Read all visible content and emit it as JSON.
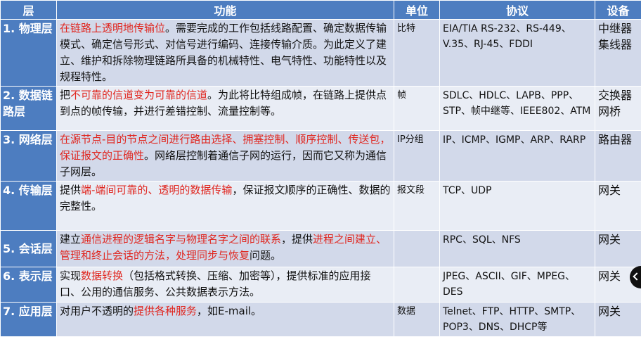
{
  "headers": {
    "layer": "层",
    "function": "功能",
    "unit": "单位",
    "protocol": "协议",
    "device": "设备"
  },
  "rows": [
    {
      "layer": "1. 物理层",
      "function": [
        {
          "t": "在链路上透明地传输位",
          "hl": true
        },
        {
          "t": "。需要完成的工作包括线路配置、确定数据传输模式、确定信号形式、对信号进行编码、连接传输介质。为此定义了建立、维护和拆除物理链路所具备的机械特性、电气特性、功能特性以及规程特性。",
          "hl": false
        }
      ],
      "unit": "比特",
      "protocol": "EIA/TIA RS-232、RS-449、V.35、RJ-45、FDDI",
      "device": "中继器 集线器"
    },
    {
      "layer": "2. 数据链路层",
      "function": [
        {
          "t": "把",
          "hl": false
        },
        {
          "t": "不可靠的信道变为可靠的信道",
          "hl": true
        },
        {
          "t": "。为此将比特组成帧，在链路上提供点到点的帧传输，并进行差错控制、流量控制等。",
          "hl": false
        }
      ],
      "unit": "帧",
      "protocol": "SDLC、HDLC、LAPB、PPP、STP、帧中继等、IEEE802、ATM",
      "device": "交换器 网桥"
    },
    {
      "layer": "3. 网络层",
      "function": [
        {
          "t": "在源节点-目的节点之间进行路由选择、拥塞控制、顺序控制、传送包，保证报文的正确性",
          "hl": true
        },
        {
          "t": "。网络层控制着通信子网的运行，因而它又称为通信子网层。",
          "hl": false
        }
      ],
      "unit": "IP分组",
      "protocol": "IP、ICMP、IGMP、ARP、RARP",
      "device": "路由器"
    },
    {
      "layer": "4. 传输层",
      "function": [
        {
          "t": "提供",
          "hl": false
        },
        {
          "t": "端-端间可靠的、透明的数据传输",
          "hl": true
        },
        {
          "t": "，保证报文顺序的正确性、数据的完整性。",
          "hl": false
        }
      ],
      "unit": "报文段",
      "protocol": "TCP、UDP",
      "device": "网关"
    },
    {
      "layer": "5. 会话层",
      "function": [
        {
          "t": "建立",
          "hl": false
        },
        {
          "t": "通信进程的逻辑名字与物理名字之间的联系",
          "hl": true
        },
        {
          "t": "，提供",
          "hl": false
        },
        {
          "t": "进程之间建立、管理和终止会话的方法，处理同步与恢复",
          "hl": true
        },
        {
          "t": "问题。",
          "hl": false
        }
      ],
      "unit": "",
      "protocol": "RPC、SQL、NFS",
      "device": "网关"
    },
    {
      "layer": "6. 表示层",
      "function": [
        {
          "t": "实现",
          "hl": false
        },
        {
          "t": "数据转换",
          "hl": true
        },
        {
          "t": "（包括格式转换、压缩、加密等），提供标准的应用接口、公用的通信服务、公共数据表示方法。",
          "hl": false
        }
      ],
      "unit": "",
      "protocol": "JPEG、ASCII、GIF、MPEG、DES",
      "device": "网关"
    },
    {
      "layer": "7. 应用层",
      "function": [
        {
          "t": "对用户不透明的",
          "hl": false
        },
        {
          "t": "提供各种服务",
          "hl": true
        },
        {
          "t": "，如E-mail。",
          "hl": false
        }
      ],
      "unit": "数据",
      "protocol": "Telnet、FTP、HTTP、SMTP、POP3、DNS、DHCP等",
      "device": "网关"
    }
  ],
  "colors": {
    "header_bg": "#4d7dc0",
    "row_odd_bg": "#d2d9ea",
    "row_even_bg": "#e9edf5",
    "highlight_text": "#e0261f"
  }
}
